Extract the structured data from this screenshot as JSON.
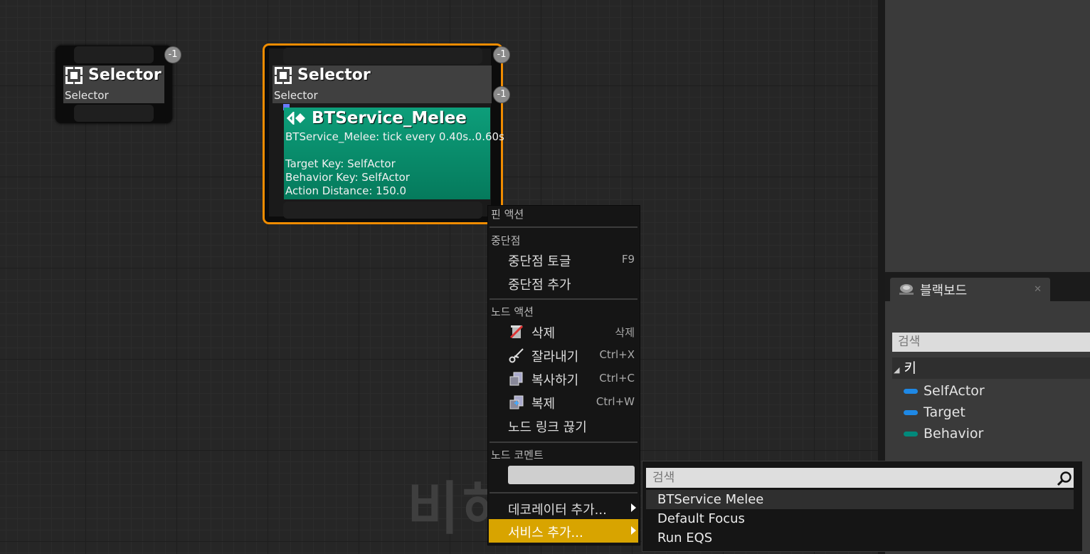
{
  "graph": {
    "watermark": "비헤",
    "node_left": {
      "title": "Selector",
      "subtitle": "Selector",
      "badge": "-1"
    },
    "node_right": {
      "title": "Selector",
      "subtitle": "Selector",
      "badge_top": "-1",
      "badge_mid": "-1",
      "service": {
        "title": "BTService_Melee",
        "desc": "BTService_Melee: tick every 0.40s..0.60s",
        "lines": [
          "Target Key: SelfActor",
          "Behavior Key: SelfActor",
          "Action Distance: 150.0"
        ]
      }
    }
  },
  "context_menu": {
    "sec_pin": "핀 액션",
    "sec_breakpoint": "중단점",
    "toggle_breakpoint": "중단점 토글",
    "toggle_breakpoint_shortcut": "F9",
    "add_breakpoint": "중단점 추가",
    "sec_node": "노드 액션",
    "delete": "삭제",
    "delete_shortcut": "삭제",
    "cut": "잘라내기",
    "cut_shortcut": "Ctrl+X",
    "copy": "복사하기",
    "copy_shortcut": "Ctrl+C",
    "duplicate": "복제",
    "duplicate_shortcut": "Ctrl+W",
    "break_links": "노드 링크 끊기",
    "sec_comment": "노드 코멘트",
    "add_decorator": "데코레이터 추가...",
    "add_service": "서비스 추가..."
  },
  "submenu": {
    "search_placeholder": "검색",
    "items": [
      "BTService Melee",
      "Default Focus",
      "Run EQS"
    ]
  },
  "blackboard": {
    "tab_title": "블랙보드",
    "search_placeholder": "검색",
    "keys_header": "키",
    "keys": [
      {
        "name": "SelfActor",
        "color": "#1e88e5"
      },
      {
        "name": "Target",
        "color": "#1e88e5"
      },
      {
        "name": "Behavior",
        "color": "#00897b"
      }
    ]
  }
}
